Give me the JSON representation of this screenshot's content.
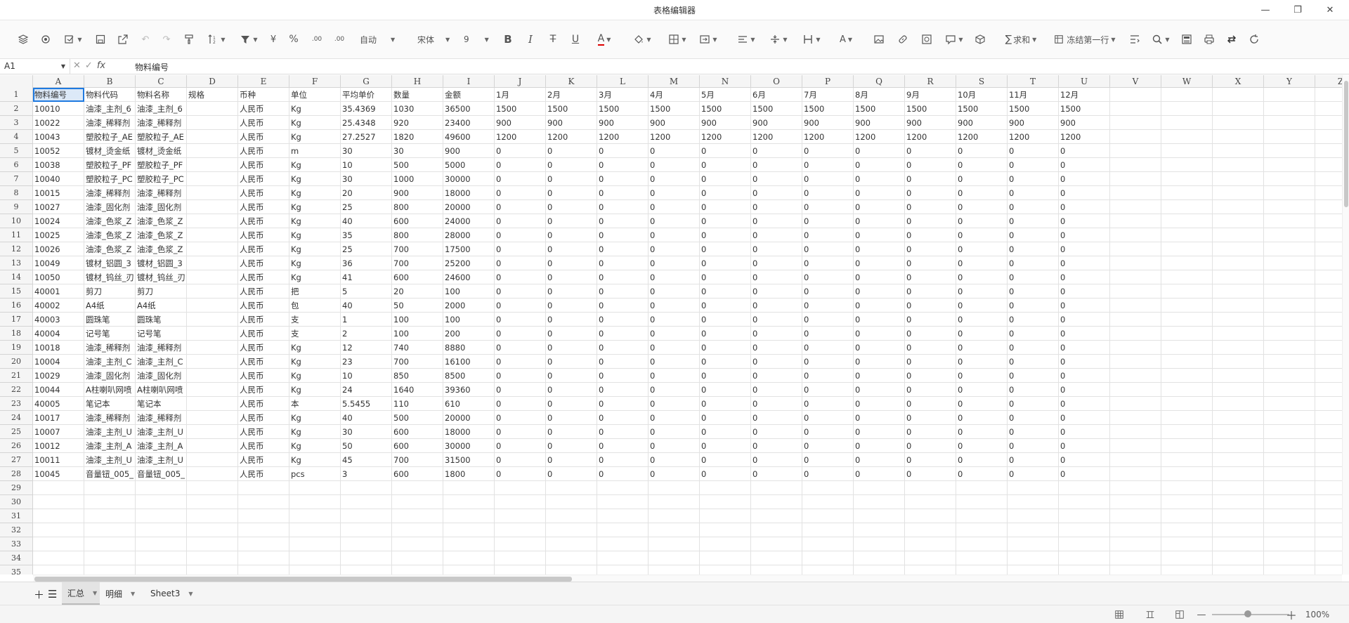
{
  "window": {
    "title": "表格编辑器",
    "minimize": "—",
    "restore": "❐",
    "close": "✕"
  },
  "toolbar": {
    "icons": [
      "layers-icon",
      "paint-bucket-icon",
      "format-brush-icon",
      "save-icon",
      "export-icon",
      "undo-icon",
      "redo-icon",
      "format-painter-icon",
      "sort-icon",
      "filter-icon"
    ],
    "currency_label": "¥",
    "percent_label": "%",
    "dec_increase_label": ".00",
    "dec_decrease_label": ".00",
    "format_label": "自动",
    "font_name": "宋体",
    "font_size": "9",
    "bold_label": "B",
    "italic_label": "I",
    "strike_label": "T",
    "underline_label": "U",
    "font_color_label": "A",
    "text_color_label": "A",
    "sum_label": "求和",
    "freeze_label": "冻结第一行"
  },
  "formula_bar": {
    "name_box": "A1",
    "fx_label": "fx",
    "value": "物料编号"
  },
  "columns": [
    "A",
    "B",
    "C",
    "D",
    "E",
    "F",
    "G",
    "H",
    "I",
    "J",
    "K",
    "L",
    "M",
    "N",
    "O",
    "P",
    "Q",
    "R",
    "S",
    "T",
    "U",
    "V",
    "W",
    "X",
    "Y",
    "Z"
  ],
  "rows_total": 35,
  "selected_cell": "A1",
  "table": {
    "header": [
      "物料编号",
      "物料代码",
      "物料名称",
      "规格",
      "币种",
      "单位",
      "平均单价",
      "数量",
      "金额",
      "1月",
      "2月",
      "3月",
      "4月",
      "5月",
      "6月",
      "7月",
      "8月",
      "9月",
      "10月",
      "11月",
      "12月"
    ],
    "rows": [
      [
        "10010",
        "油漆_主剂_6",
        "油漆_主剂_6",
        "",
        "人民币",
        "Kg",
        "35.4369",
        "1030",
        "36500",
        "1500",
        "1500",
        "1500",
        "1500",
        "1500",
        "1500",
        "1500",
        "1500",
        "1500",
        "1500",
        "1500",
        "1500"
      ],
      [
        "10022",
        "油漆_稀释剂",
        "油漆_稀释剂",
        "",
        "人民币",
        "Kg",
        "25.4348",
        "920",
        "23400",
        "900",
        "900",
        "900",
        "900",
        "900",
        "900",
        "900",
        "900",
        "900",
        "900",
        "900",
        "900"
      ],
      [
        "10043",
        "塑胶粒子_AE",
        "塑胶粒子_AE",
        "",
        "人民币",
        "Kg",
        "27.2527",
        "1820",
        "49600",
        "1200",
        "1200",
        "1200",
        "1200",
        "1200",
        "1200",
        "1200",
        "1200",
        "1200",
        "1200",
        "1200",
        "1200"
      ],
      [
        "10052",
        "镀材_烫金纸",
        "镀材_烫金纸",
        "",
        "人民币",
        "m",
        "30",
        "30",
        "900",
        "0",
        "0",
        "0",
        "0",
        "0",
        "0",
        "0",
        "0",
        "0",
        "0",
        "0",
        "0"
      ],
      [
        "10038",
        "塑胶粒子_PF",
        "塑胶粒子_PF",
        "",
        "人民币",
        "Kg",
        "10",
        "500",
        "5000",
        "0",
        "0",
        "0",
        "0",
        "0",
        "0",
        "0",
        "0",
        "0",
        "0",
        "0",
        "0"
      ],
      [
        "10040",
        "塑胶粒子_PC",
        "塑胶粒子_PC",
        "",
        "人民币",
        "Kg",
        "30",
        "1000",
        "30000",
        "0",
        "0",
        "0",
        "0",
        "0",
        "0",
        "0",
        "0",
        "0",
        "0",
        "0",
        "0"
      ],
      [
        "10015",
        "油漆_稀释剂",
        "油漆_稀释剂",
        "",
        "人民币",
        "Kg",
        "20",
        "900",
        "18000",
        "0",
        "0",
        "0",
        "0",
        "0",
        "0",
        "0",
        "0",
        "0",
        "0",
        "0",
        "0"
      ],
      [
        "10027",
        "油漆_固化剂",
        "油漆_固化剂",
        "",
        "人民币",
        "Kg",
        "25",
        "800",
        "20000",
        "0",
        "0",
        "0",
        "0",
        "0",
        "0",
        "0",
        "0",
        "0",
        "0",
        "0",
        "0"
      ],
      [
        "10024",
        "油漆_色浆_Z",
        "油漆_色浆_Z",
        "",
        "人民币",
        "Kg",
        "40",
        "600",
        "24000",
        "0",
        "0",
        "0",
        "0",
        "0",
        "0",
        "0",
        "0",
        "0",
        "0",
        "0",
        "0"
      ],
      [
        "10025",
        "油漆_色浆_Z",
        "油漆_色浆_Z",
        "",
        "人民币",
        "Kg",
        "35",
        "800",
        "28000",
        "0",
        "0",
        "0",
        "0",
        "0",
        "0",
        "0",
        "0",
        "0",
        "0",
        "0",
        "0"
      ],
      [
        "10026",
        "油漆_色浆_Z",
        "油漆_色浆_Z",
        "",
        "人民币",
        "Kg",
        "25",
        "700",
        "17500",
        "0",
        "0",
        "0",
        "0",
        "0",
        "0",
        "0",
        "0",
        "0",
        "0",
        "0",
        "0"
      ],
      [
        "10049",
        "镀材_铝圆_3",
        "镀材_铝圆_3",
        "",
        "人民币",
        "Kg",
        "36",
        "700",
        "25200",
        "0",
        "0",
        "0",
        "0",
        "0",
        "0",
        "0",
        "0",
        "0",
        "0",
        "0",
        "0"
      ],
      [
        "10050",
        "镀材_钨丝_刃",
        "镀材_钨丝_刃",
        "",
        "人民币",
        "Kg",
        "41",
        "600",
        "24600",
        "0",
        "0",
        "0",
        "0",
        "0",
        "0",
        "0",
        "0",
        "0",
        "0",
        "0",
        "0"
      ],
      [
        "40001",
        "剪刀",
        "剪刀",
        "",
        "人民币",
        "把",
        "5",
        "20",
        "100",
        "0",
        "0",
        "0",
        "0",
        "0",
        "0",
        "0",
        "0",
        "0",
        "0",
        "0",
        "0"
      ],
      [
        "40002",
        "A4纸",
        "A4纸",
        "",
        "人民币",
        "包",
        "40",
        "50",
        "2000",
        "0",
        "0",
        "0",
        "0",
        "0",
        "0",
        "0",
        "0",
        "0",
        "0",
        "0",
        "0"
      ],
      [
        "40003",
        "圆珠笔",
        "圆珠笔",
        "",
        "人民币",
        "支",
        "1",
        "100",
        "100",
        "0",
        "0",
        "0",
        "0",
        "0",
        "0",
        "0",
        "0",
        "0",
        "0",
        "0",
        "0"
      ],
      [
        "40004",
        "记号笔",
        "记号笔",
        "",
        "人民币",
        "支",
        "2",
        "100",
        "200",
        "0",
        "0",
        "0",
        "0",
        "0",
        "0",
        "0",
        "0",
        "0",
        "0",
        "0",
        "0"
      ],
      [
        "10018",
        "油漆_稀释剂",
        "油漆_稀释剂",
        "",
        "人民币",
        "Kg",
        "12",
        "740",
        "8880",
        "0",
        "0",
        "0",
        "0",
        "0",
        "0",
        "0",
        "0",
        "0",
        "0",
        "0",
        "0"
      ],
      [
        "10004",
        "油漆_主剂_C",
        "油漆_主剂_C",
        "",
        "人民币",
        "Kg",
        "23",
        "700",
        "16100",
        "0",
        "0",
        "0",
        "0",
        "0",
        "0",
        "0",
        "0",
        "0",
        "0",
        "0",
        "0"
      ],
      [
        "10029",
        "油漆_固化剂",
        "油漆_固化剂",
        "",
        "人民币",
        "Kg",
        "10",
        "850",
        "8500",
        "0",
        "0",
        "0",
        "0",
        "0",
        "0",
        "0",
        "0",
        "0",
        "0",
        "0",
        "0"
      ],
      [
        "10044",
        "A柱喇叭网喷",
        "A柱喇叭网喷",
        "",
        "人民币",
        "Kg",
        "24",
        "1640",
        "39360",
        "0",
        "0",
        "0",
        "0",
        "0",
        "0",
        "0",
        "0",
        "0",
        "0",
        "0",
        "0"
      ],
      [
        "40005",
        "笔记本",
        "笔记本",
        "",
        "人民币",
        "本",
        "5.5455",
        "110",
        "610",
        "0",
        "0",
        "0",
        "0",
        "0",
        "0",
        "0",
        "0",
        "0",
        "0",
        "0",
        "0"
      ],
      [
        "10017",
        "油漆_稀释剂",
        "油漆_稀释剂",
        "",
        "人民币",
        "Kg",
        "40",
        "500",
        "20000",
        "0",
        "0",
        "0",
        "0",
        "0",
        "0",
        "0",
        "0",
        "0",
        "0",
        "0",
        "0"
      ],
      [
        "10007",
        "油漆_主剂_U",
        "油漆_主剂_U",
        "",
        "人民币",
        "Kg",
        "30",
        "600",
        "18000",
        "0",
        "0",
        "0",
        "0",
        "0",
        "0",
        "0",
        "0",
        "0",
        "0",
        "0",
        "0"
      ],
      [
        "10012",
        "油漆_主剂_A",
        "油漆_主剂_A",
        "",
        "人民币",
        "Kg",
        "50",
        "600",
        "30000",
        "0",
        "0",
        "0",
        "0",
        "0",
        "0",
        "0",
        "0",
        "0",
        "0",
        "0",
        "0"
      ],
      [
        "10011",
        "油漆_主剂_U",
        "油漆_主剂_U",
        "",
        "人民币",
        "Kg",
        "45",
        "700",
        "31500",
        "0",
        "0",
        "0",
        "0",
        "0",
        "0",
        "0",
        "0",
        "0",
        "0",
        "0",
        "0"
      ],
      [
        "10045",
        "音量钮_005_",
        "音量钮_005_",
        "",
        "人民币",
        "pcs",
        "3",
        "600",
        "1800",
        "0",
        "0",
        "0",
        "0",
        "0",
        "0",
        "0",
        "0",
        "0",
        "0",
        "0",
        "0"
      ]
    ]
  },
  "sheets": [
    {
      "label": "汇总",
      "active": true
    },
    {
      "label": "明细",
      "active": false
    },
    {
      "label": "Sheet3",
      "active": false
    }
  ],
  "status": {
    "zoom": "100%"
  },
  "colors": {
    "selection": "#1f7ae0",
    "header_bg": "#f5f5f5",
    "font_color_bar": "#d00000"
  }
}
